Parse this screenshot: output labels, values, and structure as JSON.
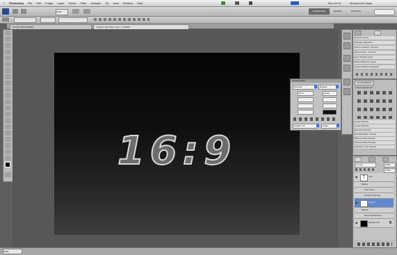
{
  "menubar": {
    "items": [
      "Photoshop",
      "File",
      "Edit",
      "Image",
      "Layer",
      "Select",
      "Filter",
      "Analysis",
      "3D",
      "View",
      "Window",
      "Help"
    ],
    "clock": "Mon 20:11",
    "user": "Mohammed Jajaa"
  },
  "appbar": {
    "zoom": "100%",
    "workspaces": [
      "ESSENTIALS",
      "DESIGN",
      "PAINTING"
    ]
  },
  "doc_tabs": [
    "16.9 @ 100% (RGB/8)",
    "Untitled-1 @ 100% (Layer 1, RGB/8)"
  ],
  "canvas": {
    "text": "16:9"
  },
  "status": {
    "zoom": "100%"
  },
  "adjust_panel": {
    "title": "ADJUSTMENTS",
    "subtitle": "Add an adjustment",
    "presets": [
      "Levels Presets",
      "Curves Presets",
      "Exposure Presets",
      "Hue/Saturation Presets",
      "Black & White Presets",
      "Channel Mixer Presets",
      "Selective Color Presets"
    ]
  },
  "actions_panel": {
    "items": [
      "Default Actions",
      "Vignette (selection)",
      "Frame Channel - 50 pixel",
      "Wood Frame - 50 pixel",
      "Cast Shadow (type)",
      "Water Reflection (type)",
      "Custom RGB to Grayscale"
    ]
  },
  "layers_panel": {
    "blend": "Normal",
    "opacity": "100%",
    "fill": "100%",
    "layers": [
      "16:9",
      "Effects",
      "Inner Glow",
      "Gradient Overlay",
      "Layer 1",
      "Effects",
      "Bevel and Emboss",
      "Background"
    ]
  },
  "char_panel": {
    "title": "CHARACTER",
    "font": "Eurostile",
    "style": "Regular",
    "size": "60 pt",
    "leading": "(Auto)",
    "language": "English: UK",
    "aa": "Sharp"
  }
}
